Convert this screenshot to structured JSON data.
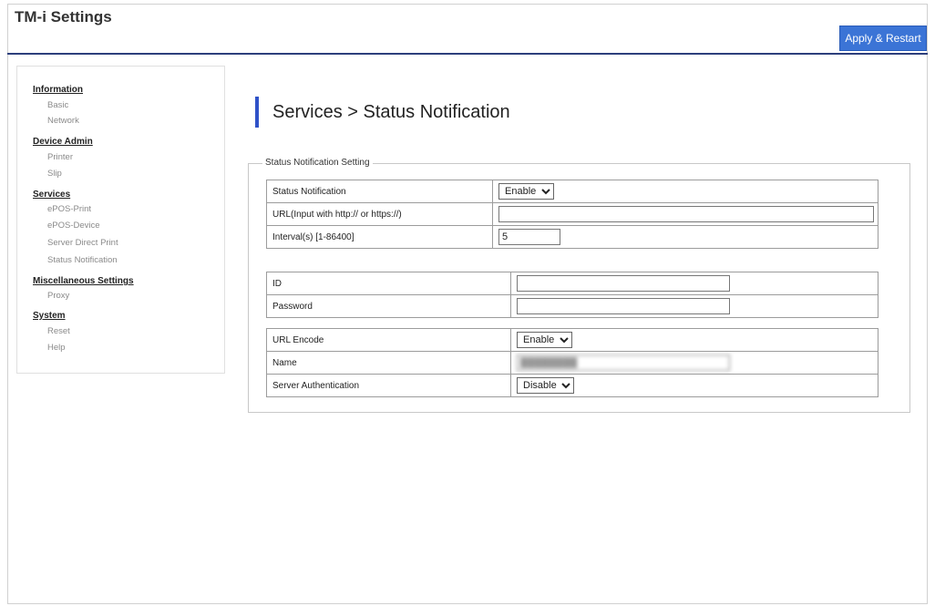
{
  "header": {
    "app_title": "TM-i Settings",
    "apply_label": "Apply & Restart"
  },
  "sidebar": {
    "groups": [
      {
        "label": "Information",
        "items": [
          "Basic",
          "Network"
        ]
      },
      {
        "label": "Device Admin",
        "items": [
          "Printer",
          "Slip"
        ]
      },
      {
        "label": "Services",
        "items": [
          "ePOS-Print",
          "ePOS-Device",
          "Server Direct Print",
          "Status Notification"
        ]
      },
      {
        "label": "Miscellaneous Settings",
        "items": [
          "Proxy"
        ]
      },
      {
        "label": "System",
        "items": [
          "Reset",
          "Help"
        ]
      }
    ]
  },
  "main": {
    "page_title": "Services > Status Notification",
    "fieldset_legend": "Status Notification Setting",
    "rows": {
      "status_notification": {
        "label": "Status Notification",
        "value": "Enable"
      },
      "url": {
        "label": "URL(Input with http:// or https://)",
        "value": ""
      },
      "interval": {
        "label": "Interval(s) [1-86400]",
        "value": "5"
      },
      "id": {
        "label": "ID",
        "value": ""
      },
      "password": {
        "label": "Password",
        "value": ""
      },
      "url_encode": {
        "label": "URL Encode",
        "value": "Enable"
      },
      "name": {
        "label": "Name",
        "value": "████████"
      },
      "server_auth": {
        "label": "Server Authentication",
        "value": "Disable"
      }
    }
  },
  "colors": {
    "accent": "#3b74d6",
    "header_line": "#2d3f7c",
    "title_bar": "#2f52c8"
  }
}
